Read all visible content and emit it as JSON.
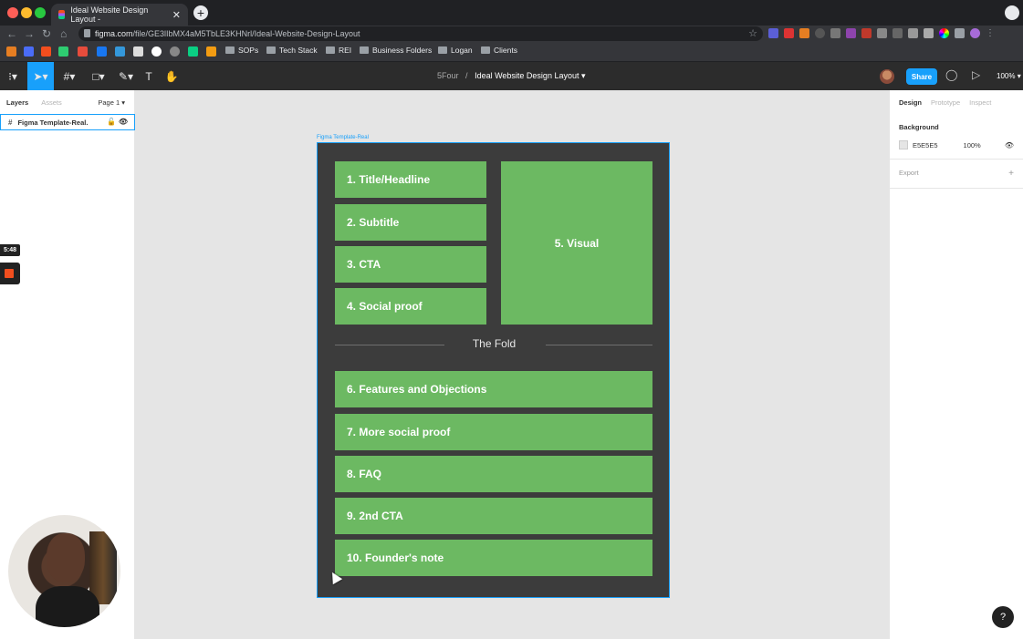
{
  "browser": {
    "tab_title": "Ideal Website Design Layout -",
    "tab_close": "✕",
    "new_tab": "+",
    "url_host": "figma.com",
    "url_path": "/file/GE3lIbMX4aM5TbLE3KHNrl/Ideal-Website-Design-Layout",
    "bookmark_folders": [
      "SOPs",
      "Tech Stack",
      "REI",
      "Business Folders",
      "Logan",
      "Clients"
    ]
  },
  "figma": {
    "project": "5Four",
    "separator": "/",
    "file_name": "Ideal Website Design Layout",
    "share_label": "Share",
    "zoom": "100%",
    "left_tabs": [
      "Layers",
      "Assets"
    ],
    "page_selector": "Page 1",
    "layer_name": "Figma Template-Real.",
    "right_tabs": [
      "Design",
      "Prototype",
      "Inspect"
    ],
    "background_heading": "Background",
    "background_hex": "E5E5E5",
    "background_opacity": "100%",
    "export_label": "Export",
    "help": "?"
  },
  "recorder": {
    "timer": "5:48"
  },
  "canvas": {
    "frame_label": "Figma Template-Real",
    "blocks": {
      "title": "1. Title/Headline",
      "subtitle": "2. Subtitle",
      "cta": "3. CTA",
      "social": "4. Social proof",
      "visual": "5. Visual",
      "features": "6. Features and Objections",
      "more_social": "7. More social proof",
      "faq": "8. FAQ",
      "cta2": "9. 2nd CTA",
      "founder": "10. Founder's note"
    },
    "fold_text": "The Fold"
  },
  "colors": {
    "block_green": "#6cb962",
    "frame_bg": "#3c3c3c",
    "accent_blue": "#18a0fb"
  }
}
